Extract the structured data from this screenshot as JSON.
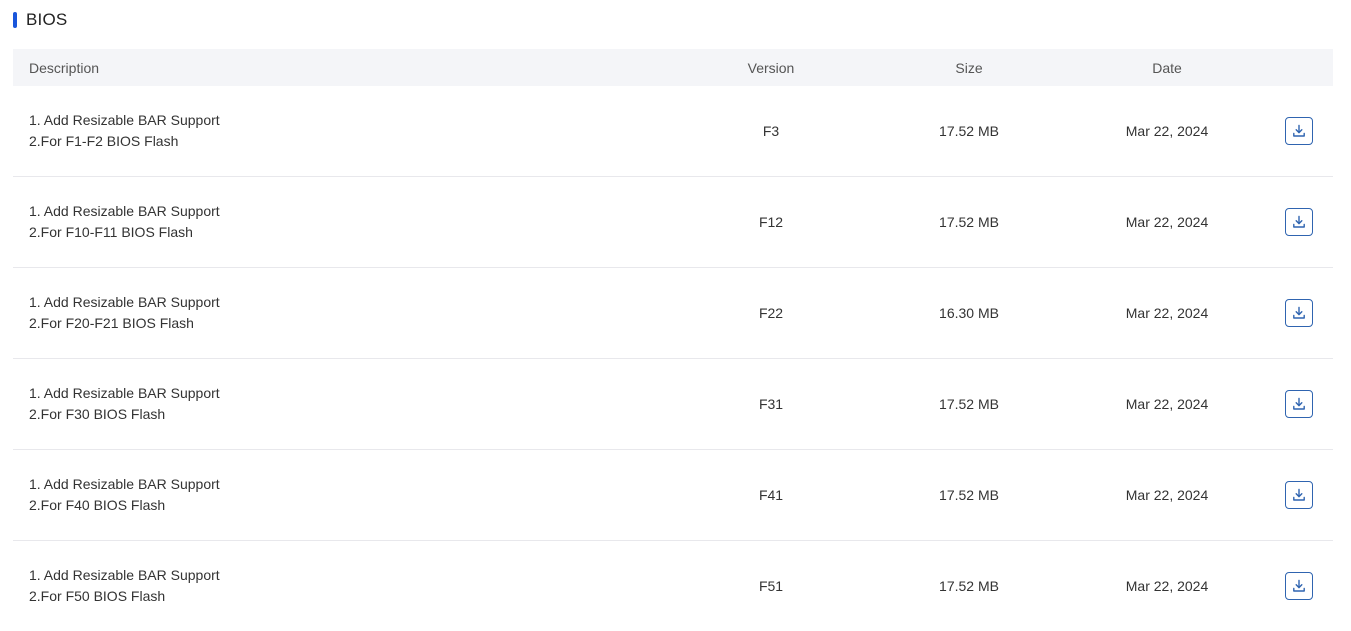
{
  "section": {
    "title": "BIOS",
    "accent_color": "#1a56db"
  },
  "table": {
    "header_bg": "#f4f5f8",
    "icon_color": "#2f64b0",
    "columns": {
      "description": "Description",
      "version": "Version",
      "size": "Size",
      "date": "Date"
    },
    "rows": [
      {
        "desc_line1": "1. Add Resizable BAR Support",
        "desc_line2": "2.For F1-F2 BIOS Flash",
        "version": "F3",
        "size": "17.52 MB",
        "date": "Mar 22, 2024",
        "action_icon": "download-icon"
      },
      {
        "desc_line1": "1. Add Resizable BAR Support",
        "desc_line2": "2.For F10-F11 BIOS Flash",
        "version": "F12",
        "size": "17.52 MB",
        "date": "Mar 22, 2024",
        "action_icon": "download-icon"
      },
      {
        "desc_line1": "1. Add Resizable BAR Support",
        "desc_line2": "2.For F20-F21 BIOS Flash",
        "version": "F22",
        "size": "16.30 MB",
        "date": "Mar 22, 2024",
        "action_icon": "download-icon"
      },
      {
        "desc_line1": "1. Add Resizable BAR Support",
        "desc_line2": "2.For F30 BIOS Flash",
        "version": "F31",
        "size": "17.52 MB",
        "date": "Mar 22, 2024",
        "action_icon": "download-icon"
      },
      {
        "desc_line1": "1. Add Resizable BAR Support",
        "desc_line2": "2.For F40 BIOS Flash",
        "version": "F41",
        "size": "17.52 MB",
        "date": "Mar 22, 2024",
        "action_icon": "download-icon"
      },
      {
        "desc_line1": "1. Add Resizable BAR Support",
        "desc_line2": "2.For F50 BIOS Flash",
        "version": "F51",
        "size": "17.52 MB",
        "date": "Mar 22, 2024",
        "action_icon": "download-icon"
      }
    ]
  }
}
